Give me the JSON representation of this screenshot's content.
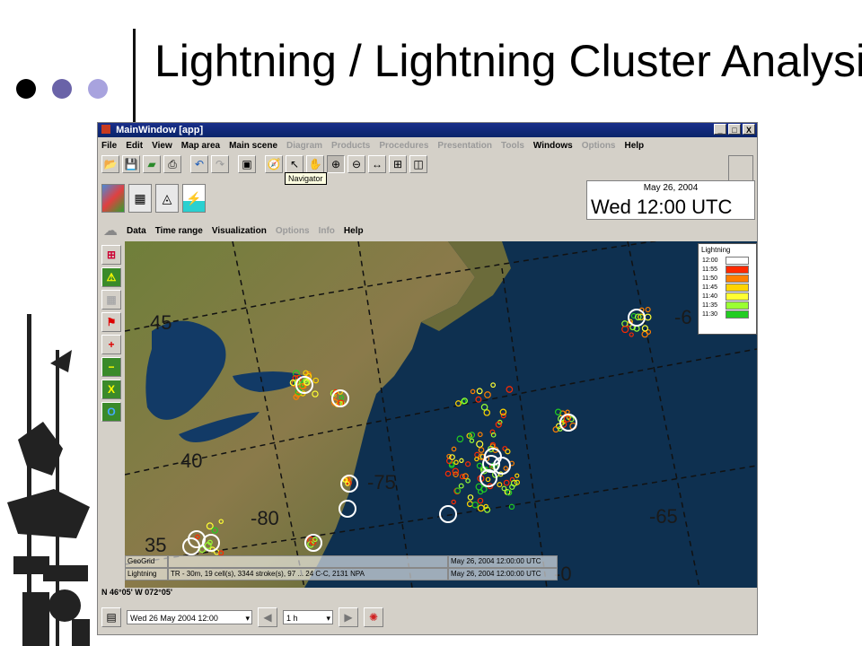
{
  "slide": {
    "title": "Lightning / Lightning Cluster Analysis"
  },
  "window": {
    "title": "MainWindow [app]",
    "controls": [
      "_",
      "□",
      "X"
    ],
    "menu": [
      {
        "label": "File",
        "enabled": true
      },
      {
        "label": "Edit",
        "enabled": true
      },
      {
        "label": "View",
        "enabled": true
      },
      {
        "label": "Map area",
        "enabled": true
      },
      {
        "label": "Main scene",
        "enabled": true
      },
      {
        "label": "Diagram",
        "enabled": false
      },
      {
        "label": "Products",
        "enabled": false
      },
      {
        "label": "Procedures",
        "enabled": false
      },
      {
        "label": "Presentation",
        "enabled": false
      },
      {
        "label": "Tools",
        "enabled": false
      },
      {
        "label": "Windows",
        "enabled": true
      },
      {
        "label": "Options",
        "enabled": false
      },
      {
        "label": "Help",
        "enabled": true
      }
    ],
    "tooltip": "Navigator",
    "time": {
      "date": "May 26, 2004",
      "clock": "Wed 12:00 UTC"
    },
    "submenu": [
      {
        "label": "Data",
        "enabled": true
      },
      {
        "label": "Time range",
        "enabled": true
      },
      {
        "label": "Visualization",
        "enabled": true
      },
      {
        "label": "Options",
        "enabled": false
      },
      {
        "label": "Info",
        "enabled": false
      },
      {
        "label": "Help",
        "enabled": true
      }
    ]
  },
  "map": {
    "grid_labels": [
      {
        "text": "45",
        "kind": "lat"
      },
      {
        "text": "40",
        "kind": "lat"
      },
      {
        "text": "35",
        "kind": "lat"
      },
      {
        "text": "-80",
        "kind": "lon"
      },
      {
        "text": "-75",
        "kind": "lon"
      },
      {
        "text": "-65",
        "kind": "lon"
      },
      {
        "text": "-6",
        "kind": "lon"
      },
      {
        "text": "-0",
        "kind": "lon"
      }
    ],
    "legend": {
      "title": "Lightning",
      "entries": [
        {
          "time": "12:00",
          "color": "#ffffff"
        },
        {
          "time": "11:55",
          "color": "#ff2a00"
        },
        {
          "time": "11:50",
          "color": "#ff7f00"
        },
        {
          "time": "11:45",
          "color": "#ffd400"
        },
        {
          "time": "11:40",
          "color": "#ffff33"
        },
        {
          "time": "11:35",
          "color": "#9aff33"
        },
        {
          "time": "11:30",
          "color": "#22cc22"
        }
      ]
    },
    "info_rows": [
      [
        "GeoGrid",
        "",
        "May 26, 2004 12:00:00 UTC"
      ],
      [
        "Lightning",
        "TR - 30m, 19 cell(s), 3344 stroke(s), 97 ... 24 C-C, 2131 NPA",
        "May 26, 2004 12:00:00 UTC"
      ]
    ]
  },
  "status": {
    "coords": "N 46°05' W 072°05'"
  },
  "bottombar": {
    "datetime": "Wed 26 May 2004 12:00",
    "step": "1 h"
  }
}
